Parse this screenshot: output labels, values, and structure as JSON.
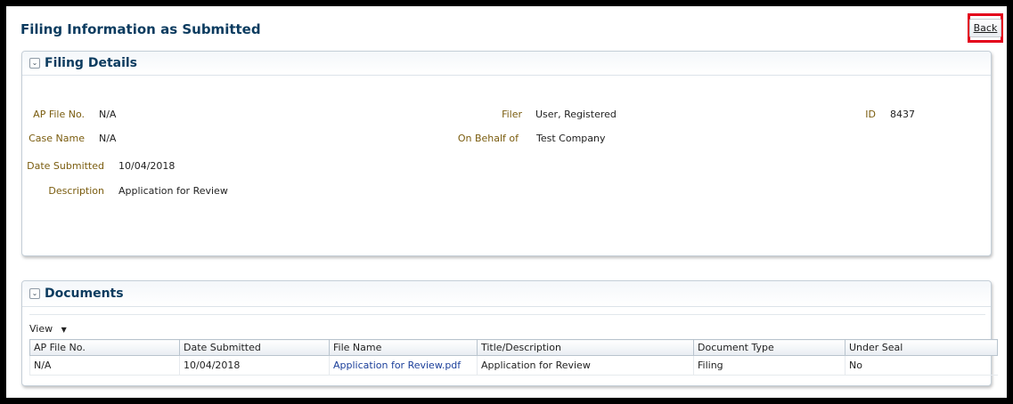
{
  "page_title": "Filing Information as Submitted",
  "back_label": "Back",
  "filing_details": {
    "title": "Filing Details",
    "ap_file_no_label": "AP File No.",
    "ap_file_no": "N/A",
    "case_name_label": "Case Name",
    "case_name": "N/A",
    "date_submitted_label": "Date Submitted",
    "date_submitted": "10/04/2018",
    "description_label": "Description",
    "description": "Application for Review",
    "filer_label": "Filer",
    "filer": "User, Registered",
    "on_behalf_label": "On Behalf of",
    "on_behalf": "Test Company",
    "id_label": "ID",
    "id": "8437"
  },
  "documents": {
    "title": "Documents",
    "view_label": "View",
    "columns": [
      "AP File No.",
      "Date Submitted",
      "File Name",
      "Title/Description",
      "Document Type",
      "Under Seal"
    ],
    "rows": [
      {
        "ap_file_no": "N/A",
        "date_submitted": "10/04/2018",
        "file_name": "Application for Review.pdf",
        "title": "Application for Review",
        "document_type": "Filing",
        "under_seal": "No"
      }
    ]
  },
  "colors": {
    "title": "#0b3b5f",
    "label": "#7a5c0e",
    "link": "#1b3f9a",
    "highlight": "#e3001b"
  },
  "icons": {
    "disclosure": "chevron-down-icon",
    "view_menu": "caret-down-icon"
  }
}
